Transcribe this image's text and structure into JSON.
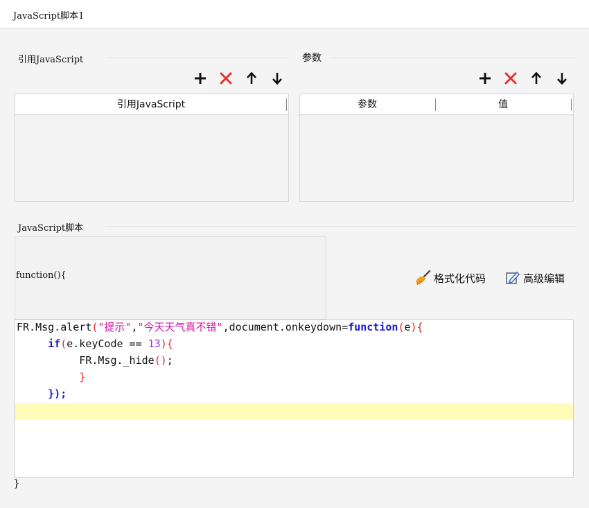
{
  "title": "JavaScript脚本1",
  "ref_section": {
    "label": "引用JavaScript",
    "column": "引用JavaScript"
  },
  "param_section": {
    "label": "参数",
    "columns": [
      "参数",
      "值"
    ]
  },
  "script_section": {
    "label": "JavaScript脚本",
    "function_header": "function(){",
    "format_code_label": "格式化代码",
    "advanced_edit_label": "高级编辑",
    "closing_brace": "}"
  },
  "toolbar_icons": [
    "plus-icon",
    "delete-x-icon",
    "arrow-up-icon",
    "arrow-down-icon"
  ],
  "code_lines": [
    [
      {
        "t": "FR.Msg.alert",
        "c": "plain"
      },
      {
        "t": "(",
        "c": "punc"
      },
      {
        "t": "\"提示\"",
        "c": "str"
      },
      {
        "t": ",",
        "c": "plain"
      },
      {
        "t": "\"今天天气真不错\"",
        "c": "str"
      },
      {
        "t": ",document.onkeydown=",
        "c": "plain"
      },
      {
        "t": "function",
        "c": "kw"
      },
      {
        "t": "(",
        "c": "punc"
      },
      {
        "t": "e",
        "c": "plain"
      },
      {
        "t": "){",
        "c": "punc"
      }
    ],
    [
      {
        "t": "     ",
        "c": "plain"
      },
      {
        "t": "if",
        "c": "kw"
      },
      {
        "t": "(",
        "c": "punc"
      },
      {
        "t": "e.keyCode == ",
        "c": "plain"
      },
      {
        "t": "13",
        "c": "num"
      },
      {
        "t": "){",
        "c": "punc"
      }
    ],
    [
      {
        "t": "          FR.Msg._hide",
        "c": "plain"
      },
      {
        "t": "()",
        "c": "punc"
      },
      {
        "t": ";",
        "c": "plain"
      }
    ],
    [
      {
        "t": "          ",
        "c": "plain"
      },
      {
        "t": "}",
        "c": "punc"
      }
    ],
    [
      {
        "t": "     ",
        "c": "plain"
      },
      {
        "t": "});",
        "c": "kw"
      }
    ],
    []
  ],
  "colors": {
    "delete": "#e8302b",
    "keyword": "#1a1ad0",
    "string": "#d11aa8",
    "number": "#8a3fd1",
    "current_line": "#fffbb8"
  }
}
